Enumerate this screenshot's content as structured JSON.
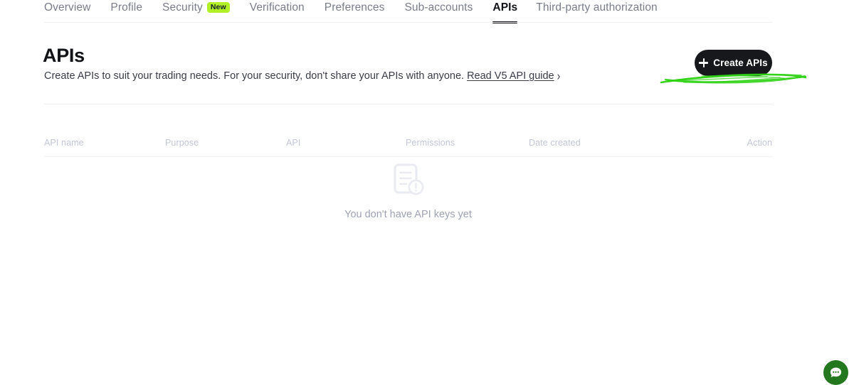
{
  "nav": {
    "tabs": [
      {
        "label": "Overview",
        "active": false,
        "badge": null
      },
      {
        "label": "Profile",
        "active": false,
        "badge": null
      },
      {
        "label": "Security",
        "active": false,
        "badge": "New"
      },
      {
        "label": "Verification",
        "active": false,
        "badge": null
      },
      {
        "label": "Preferences",
        "active": false,
        "badge": null
      },
      {
        "label": "Sub-accounts",
        "active": false,
        "badge": null
      },
      {
        "label": "APIs",
        "active": true,
        "badge": null
      },
      {
        "label": "Third-party authorization",
        "active": false,
        "badge": null
      }
    ]
  },
  "header": {
    "title": "APIs",
    "description": "Create APIs to suit your trading needs. For your security, don't share your APIs with anyone.",
    "link_label": "Read V5 API guide",
    "link_chevron": "›"
  },
  "actions": {
    "create_label": "Create APIs",
    "create_icon": "plus-icon"
  },
  "annotation": {
    "type": "scribble-underline",
    "color": "#2fd215"
  },
  "table": {
    "columns": [
      "API name",
      "Purpose",
      "API",
      "Permissions",
      "Date created",
      "Action"
    ],
    "rows": []
  },
  "empty_state": {
    "icon": "document-alert-icon",
    "message": "You don't have API keys yet"
  },
  "chat": {
    "icon": "chat-bubble-icon",
    "color": "#23781f"
  },
  "colors": {
    "accent_badge": "#b1f024",
    "button_bg": "#17181c",
    "active_tab": "#121317",
    "inactive_tab": "#7a7d89",
    "table_header": "#c3c6d4",
    "empty_text": "#9ea3b2",
    "scribble": "#2fd215",
    "chat_green": "#23781f"
  }
}
